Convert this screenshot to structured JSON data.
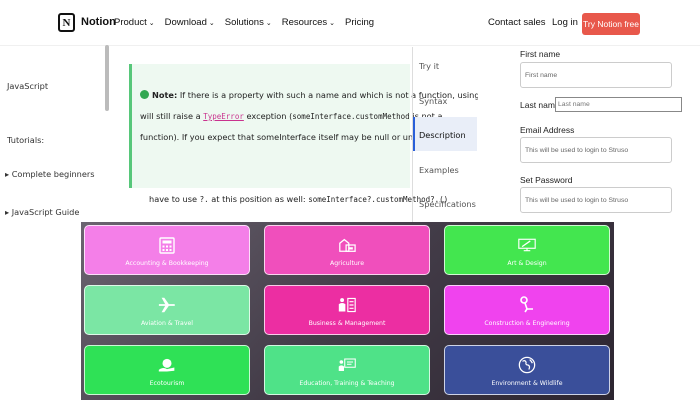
{
  "header": {
    "brand": "Notion",
    "logo_letter": "N",
    "menu": [
      {
        "label": "Product",
        "caret": "⌄"
      },
      {
        "label": "Download",
        "caret": "⌄"
      },
      {
        "label": "Solutions",
        "caret": "⌄"
      },
      {
        "label": "Resources",
        "caret": "⌄"
      },
      {
        "label": "Pricing",
        "caret": ""
      }
    ],
    "contact_sales": "Contact sales",
    "login": "Log in",
    "cta": "Try Notion free"
  },
  "mdn": {
    "sidebar": {
      "javascript": "JavaScript",
      "tutorials": "Tutorials:",
      "items": [
        "▸ Complete beginners",
        "▸ JavaScript Guide"
      ]
    },
    "note": {
      "label": "Note:",
      "line1_text": "If there is a property with such a name and which is not a function, using",
      "line1_code": "?.",
      "line2_a": "will still raise a",
      "line2_link": "TypeError",
      "line2_b": "exception (",
      "line2_code1": "someInterface.customMethod",
      "line2_c": "is not a",
      "line3": "function). If you expect that someInterface itself may be null or undefined, you",
      "after_a": "have to use",
      "after_code1": "?.",
      "after_b": "at this position as well:",
      "after_code2": "someInterface?.customMethod?.()"
    },
    "toc": [
      "Try it",
      "Syntax",
      "Description",
      "Examples",
      "Specifications"
    ]
  },
  "form": {
    "first_name": {
      "label": "First name",
      "placeholder": "First name"
    },
    "last_name": {
      "label": "Last name",
      "placeholder": "Last name"
    },
    "email": {
      "label": "Email Address",
      "placeholder": "This will be used to login to Struso"
    },
    "password": {
      "label": "Set Password",
      "placeholder": "This will be used to login to Struso"
    }
  },
  "tiles": [
    {
      "label": "Accounting & Bookkeeping",
      "color": "#f47fe8",
      "icon": "calculator-icon"
    },
    {
      "label": "Agriculture",
      "color": "#f04fbc",
      "icon": "barn-icon"
    },
    {
      "label": "Art & Design",
      "color": "#43e64f",
      "icon": "monitor-design-icon"
    },
    {
      "label": "Aviation & Travel",
      "color": "#7be6a4",
      "icon": "airplane-icon"
    },
    {
      "label": "Business & Management",
      "color": "#ec2ea2",
      "icon": "management-icon"
    },
    {
      "label": "Construction & Engineering",
      "color": "#f043ee",
      "icon": "construction-icon"
    },
    {
      "label": "Ecotourism",
      "color": "#2fe156",
      "icon": "globe-hand-icon"
    },
    {
      "label": "Education, Training & Teaching",
      "color": "#4fe288",
      "icon": "teacher-board-icon"
    },
    {
      "label": "Environment & Wildlife",
      "color": "#3a4f9a",
      "icon": "earth-icon"
    }
  ]
}
